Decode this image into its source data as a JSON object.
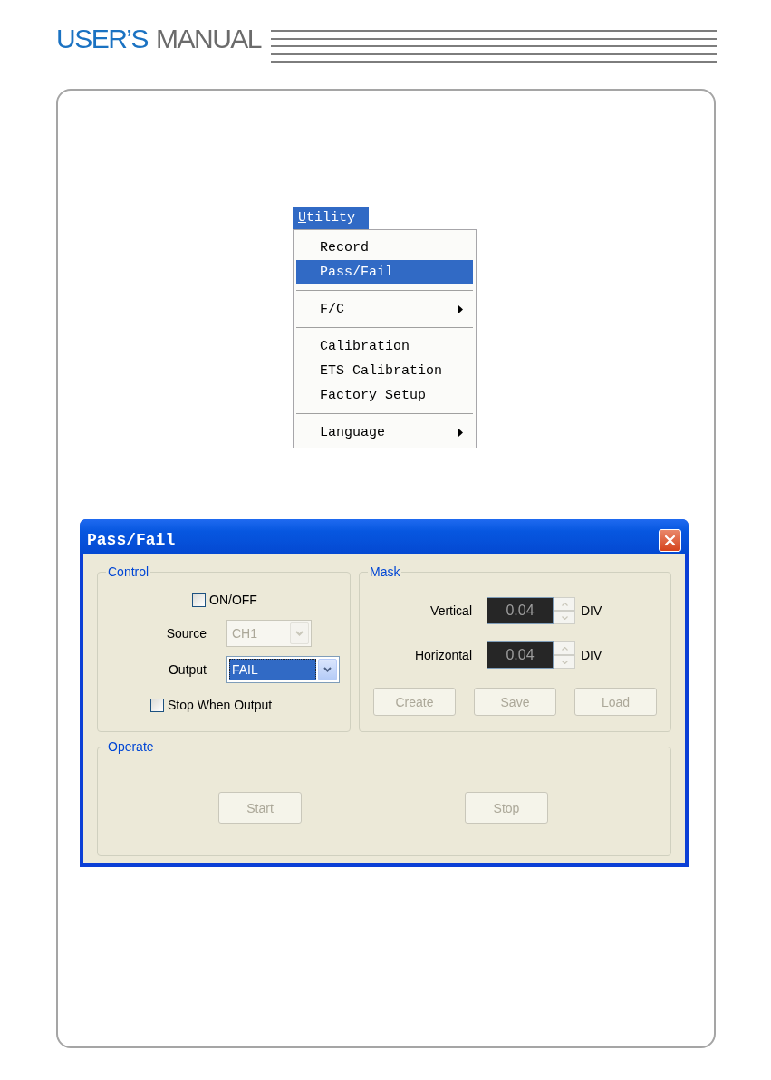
{
  "header": {
    "title_words": [
      {
        "text": "USER’S",
        "color": "#1a72c2"
      },
      {
        "text": "MANUAL",
        "color": "#6b6b6b"
      }
    ]
  },
  "menu": {
    "title": "Utility",
    "active": true,
    "underline_first_letter": true,
    "items": [
      {
        "kind": "item",
        "label": "Record",
        "selected": false,
        "submenu": false
      },
      {
        "kind": "item",
        "label": "Pass/Fail",
        "selected": true,
        "submenu": false
      },
      {
        "kind": "separator"
      },
      {
        "kind": "item",
        "label": "F/C",
        "selected": false,
        "submenu": true
      },
      {
        "kind": "separator"
      },
      {
        "kind": "item",
        "label": "Calibration",
        "selected": false,
        "submenu": false
      },
      {
        "kind": "item",
        "label": "ETS Calibration",
        "selected": false,
        "submenu": false
      },
      {
        "kind": "item",
        "label": "Factory Setup",
        "selected": false,
        "submenu": false
      },
      {
        "kind": "separator"
      },
      {
        "kind": "item",
        "label": "Language",
        "selected": false,
        "submenu": true
      }
    ]
  },
  "dialog": {
    "title": "Pass/Fail",
    "control": {
      "title": "Control",
      "on_off": {
        "label": "ON/OFF",
        "checked": false
      },
      "source": {
        "label": "Source",
        "value": "CH1",
        "disabled": true,
        "focused": false
      },
      "output": {
        "label": "Output",
        "value": "FAIL",
        "disabled": false,
        "focused": true
      },
      "stop_when_output": {
        "label": "Stop When Output",
        "checked": false
      }
    },
    "mask": {
      "title": "Mask",
      "fields": [
        {
          "label": "Vertical",
          "value": "0.04",
          "unit": "DIV",
          "disabled": true
        },
        {
          "label": "Horizontal",
          "value": "0.04",
          "unit": "DIV",
          "disabled": true
        }
      ],
      "buttons": [
        {
          "label": "Create",
          "disabled": true
        },
        {
          "label": "Save",
          "disabled": true
        },
        {
          "label": "Load",
          "disabled": true
        }
      ]
    },
    "operate": {
      "title": "Operate",
      "buttons": [
        {
          "label": "Start",
          "disabled": true
        },
        {
          "label": "Stop",
          "disabled": true
        }
      ]
    }
  }
}
